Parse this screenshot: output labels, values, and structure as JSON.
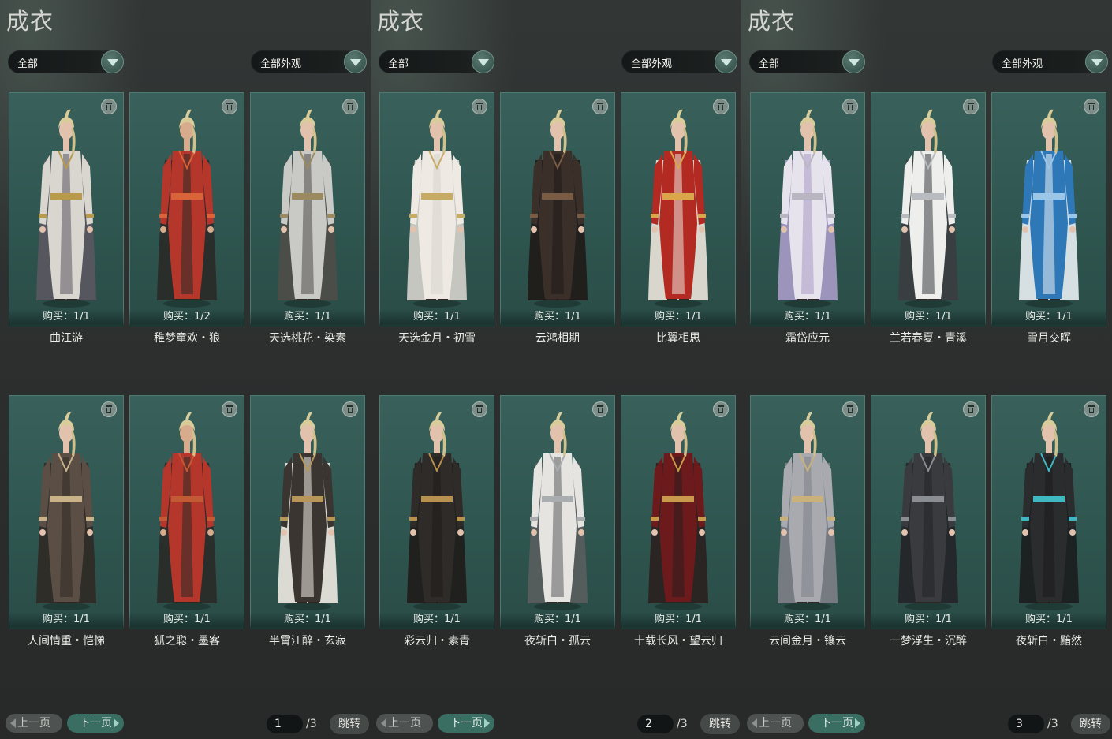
{
  "panels": [
    {
      "title": "成衣",
      "filter_left": "全部",
      "filter_right": "全部外观",
      "row1": [
        {
          "buy_text": "购买：1/1",
          "name": "曲江游",
          "palette": {
            "main": "#d9d6d0",
            "accent": "#5b5660",
            "trim": "#b99a4b",
            "skin": "#e2c2ac"
          }
        },
        {
          "buy_text": "购买：1/2",
          "name": "稚梦童欢・狼",
          "palette": {
            "main": "#b5362a",
            "accent": "#2a2a28",
            "trim": "#d9643a",
            "skin": "#d8ab8d"
          }
        },
        {
          "buy_text": "购买：1/1",
          "name": "天选桃花・染素",
          "palette": {
            "main": "#c9c9c5",
            "accent": "#4f4c48",
            "trim": "#9b8a60",
            "skin": "#e2c2ac"
          }
        }
      ],
      "row2": [
        {
          "buy_text": "购买：1/1",
          "name": "人间情重・恺悌",
          "palette": {
            "main": "#5a4e45",
            "accent": "#2f2925",
            "trim": "#c9b28a",
            "skin": "#e2c2ac"
          }
        },
        {
          "buy_text": "购买：1/1",
          "name": "狐之聪・墨客",
          "palette": {
            "main": "#b5362a",
            "accent": "#2a2a28",
            "trim": "#c25a35",
            "skin": "#d8ab8d"
          }
        },
        {
          "buy_text": "购买：1/1",
          "name": "半霄江醉・玄寂",
          "palette": {
            "main": "#3a3531",
            "accent": "#eeeae2",
            "trim": "#b69659",
            "skin": "#e2c2ac"
          }
        }
      ],
      "pagination": {
        "prev_label": "上一页",
        "next_label": "下一页",
        "current_page": "1",
        "total_text": "/3",
        "jump_label": "跳转"
      }
    },
    {
      "title": "成衣",
      "filter_left": "全部",
      "filter_right": "全部外观",
      "row1": [
        {
          "buy_text": "购买：1/1",
          "name": "天选金月・初雪",
          "palette": {
            "main": "#eeeae3",
            "accent": "#d6d3cc",
            "trim": "#c7aa64",
            "skin": "#e2c2ac"
          }
        },
        {
          "buy_text": "购买：1/1",
          "name": "云鸿相期",
          "palette": {
            "main": "#3b2f2a",
            "accent": "#1f1a17",
            "trim": "#7a5c44",
            "skin": "#e2c2ac"
          }
        },
        {
          "buy_text": "购买：1/1",
          "name": "比翼相思",
          "palette": {
            "main": "#b22a22",
            "accent": "#ece6dc",
            "trim": "#d9a64a",
            "skin": "#e2c2ac"
          }
        }
      ],
      "row2": [
        {
          "buy_text": "购买：1/1",
          "name": "彩云归・素青",
          "palette": {
            "main": "#2f2b28",
            "accent": "#1f1c1a",
            "trim": "#b7924e",
            "skin": "#e2c2ac"
          }
        },
        {
          "buy_text": "购买：1/1",
          "name": "夜斩白・孤云",
          "palette": {
            "main": "#e6e4e0",
            "accent": "#5a5d5e",
            "trim": "#a9adb0",
            "skin": "#e2c2ac"
          }
        },
        {
          "buy_text": "购买：1/1",
          "name": "十载长风・望云归",
          "palette": {
            "main": "#6d1a1c",
            "accent": "#2a1f1f",
            "trim": "#c99a4b",
            "skin": "#e2c2ac"
          }
        }
      ],
      "pagination": {
        "prev_label": "上一页",
        "next_label": "下一页",
        "current_page": "2",
        "total_text": "/3",
        "jump_label": "跳转"
      }
    },
    {
      "title": "成衣",
      "filter_left": "全部",
      "filter_right": "全部外观",
      "row1": [
        {
          "buy_text": "购买：1/1",
          "name": "霜岱应元",
          "palette": {
            "main": "#e7e3ec",
            "accent": "#a99bc6",
            "trim": "#b9b6c2",
            "skin": "#e2c2ac"
          }
        },
        {
          "buy_text": "购买：1/1",
          "name": "兰若春夏・青溪",
          "palette": {
            "main": "#eeeeec",
            "accent": "#3b3d40",
            "trim": "#b8bcc0",
            "skin": "#e2c2ac"
          }
        },
        {
          "buy_text": "购买：1/1",
          "name": "雪月交晖",
          "palette": {
            "main": "#2f78b8",
            "accent": "#e9eef2",
            "trim": "#9cc6e8",
            "skin": "#e2c2ac"
          }
        }
      ],
      "row2": [
        {
          "buy_text": "购买：1/1",
          "name": "云间金月・镶云",
          "palette": {
            "main": "#a9aab0",
            "accent": "#7e8088",
            "trim": "#c9b27a",
            "skin": "#e2c2ac"
          }
        },
        {
          "buy_text": "购买：1/1",
          "name": "一梦浮生・沉醉",
          "palette": {
            "main": "#3a3b3e",
            "accent": "#232427",
            "trim": "#8a8e93",
            "skin": "#e2c2ac"
          }
        },
        {
          "buy_text": "购买：1/1",
          "name": "夜斩白・黯然",
          "palette": {
            "main": "#2b2c2e",
            "accent": "#1b1c1e",
            "trim": "#3fb8c2",
            "skin": "#e2c2ac"
          }
        }
      ],
      "pagination": {
        "prev_label": "上一页",
        "next_label": "下一页",
        "current_page": "3",
        "total_text": "/3",
        "jump_label": "跳转"
      }
    }
  ]
}
